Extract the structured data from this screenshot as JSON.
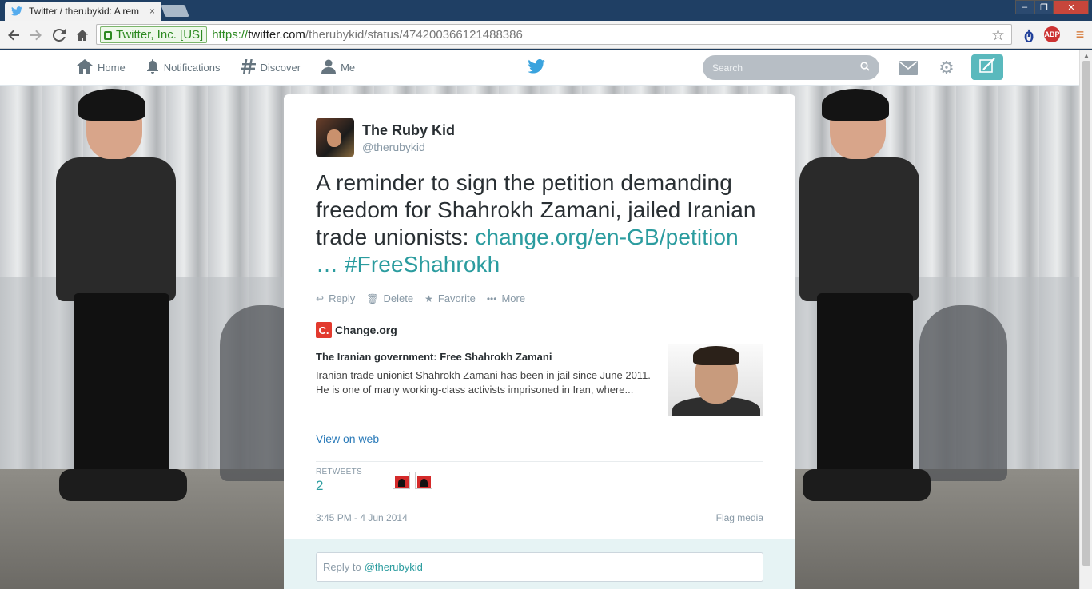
{
  "browser": {
    "tab_title": "Twitter / therubykid: A rem",
    "tab_close": "×",
    "window_min": "–",
    "window_max": "❐",
    "window_close": "✕",
    "ev_badge": "Twitter, Inc. [US]",
    "url_scheme": "https://",
    "url_host": "twitter.com",
    "url_path": "/therubykid/status/474200366121488386",
    "ext_abp": "ABP"
  },
  "twitter_nav": {
    "items": [
      {
        "label": "Home",
        "icon": "home-icon"
      },
      {
        "label": "Notifications",
        "icon": "bell-icon"
      },
      {
        "label": "Discover",
        "icon": "hash-icon"
      },
      {
        "label": "Me",
        "icon": "person-icon"
      }
    ],
    "search_placeholder": "Search"
  },
  "tweet": {
    "fullname": "The Ruby Kid",
    "handle": "@therubykid",
    "text_plain": "A reminder to sign the petition demanding freedom for Shahrokh Zamani, jailed Iranian trade unionists: ",
    "text_link": "change.org/en-GB/petition …",
    "text_hashtag": "#FreeShahrokh",
    "actions": {
      "reply": "Reply",
      "delete": "Delete",
      "favorite": "Favorite",
      "more": "More"
    },
    "card": {
      "source_logo": "C.",
      "source": "Change.org",
      "title": "The Iranian government: Free Shahrokh Zamani",
      "description": "Iranian trade unionist Shahrokh Zamani has been in jail since June 2011. He is one of many working-class activists imprisoned in Iran, where...",
      "view_on_web": "View on web"
    },
    "stats": {
      "retweets_label": "RETWEETS",
      "retweets_count": "2"
    },
    "timestamp": "3:45 PM - 4 Jun 2014",
    "flag_media": "Flag media",
    "reply_prefix": "Reply to",
    "reply_mention": "@therubykid"
  },
  "colors": {
    "twitter_teal": "#2b9c9f",
    "compose_bg": "#5ab9bd",
    "text_dark": "#292f33",
    "text_muted": "#8899a6"
  }
}
